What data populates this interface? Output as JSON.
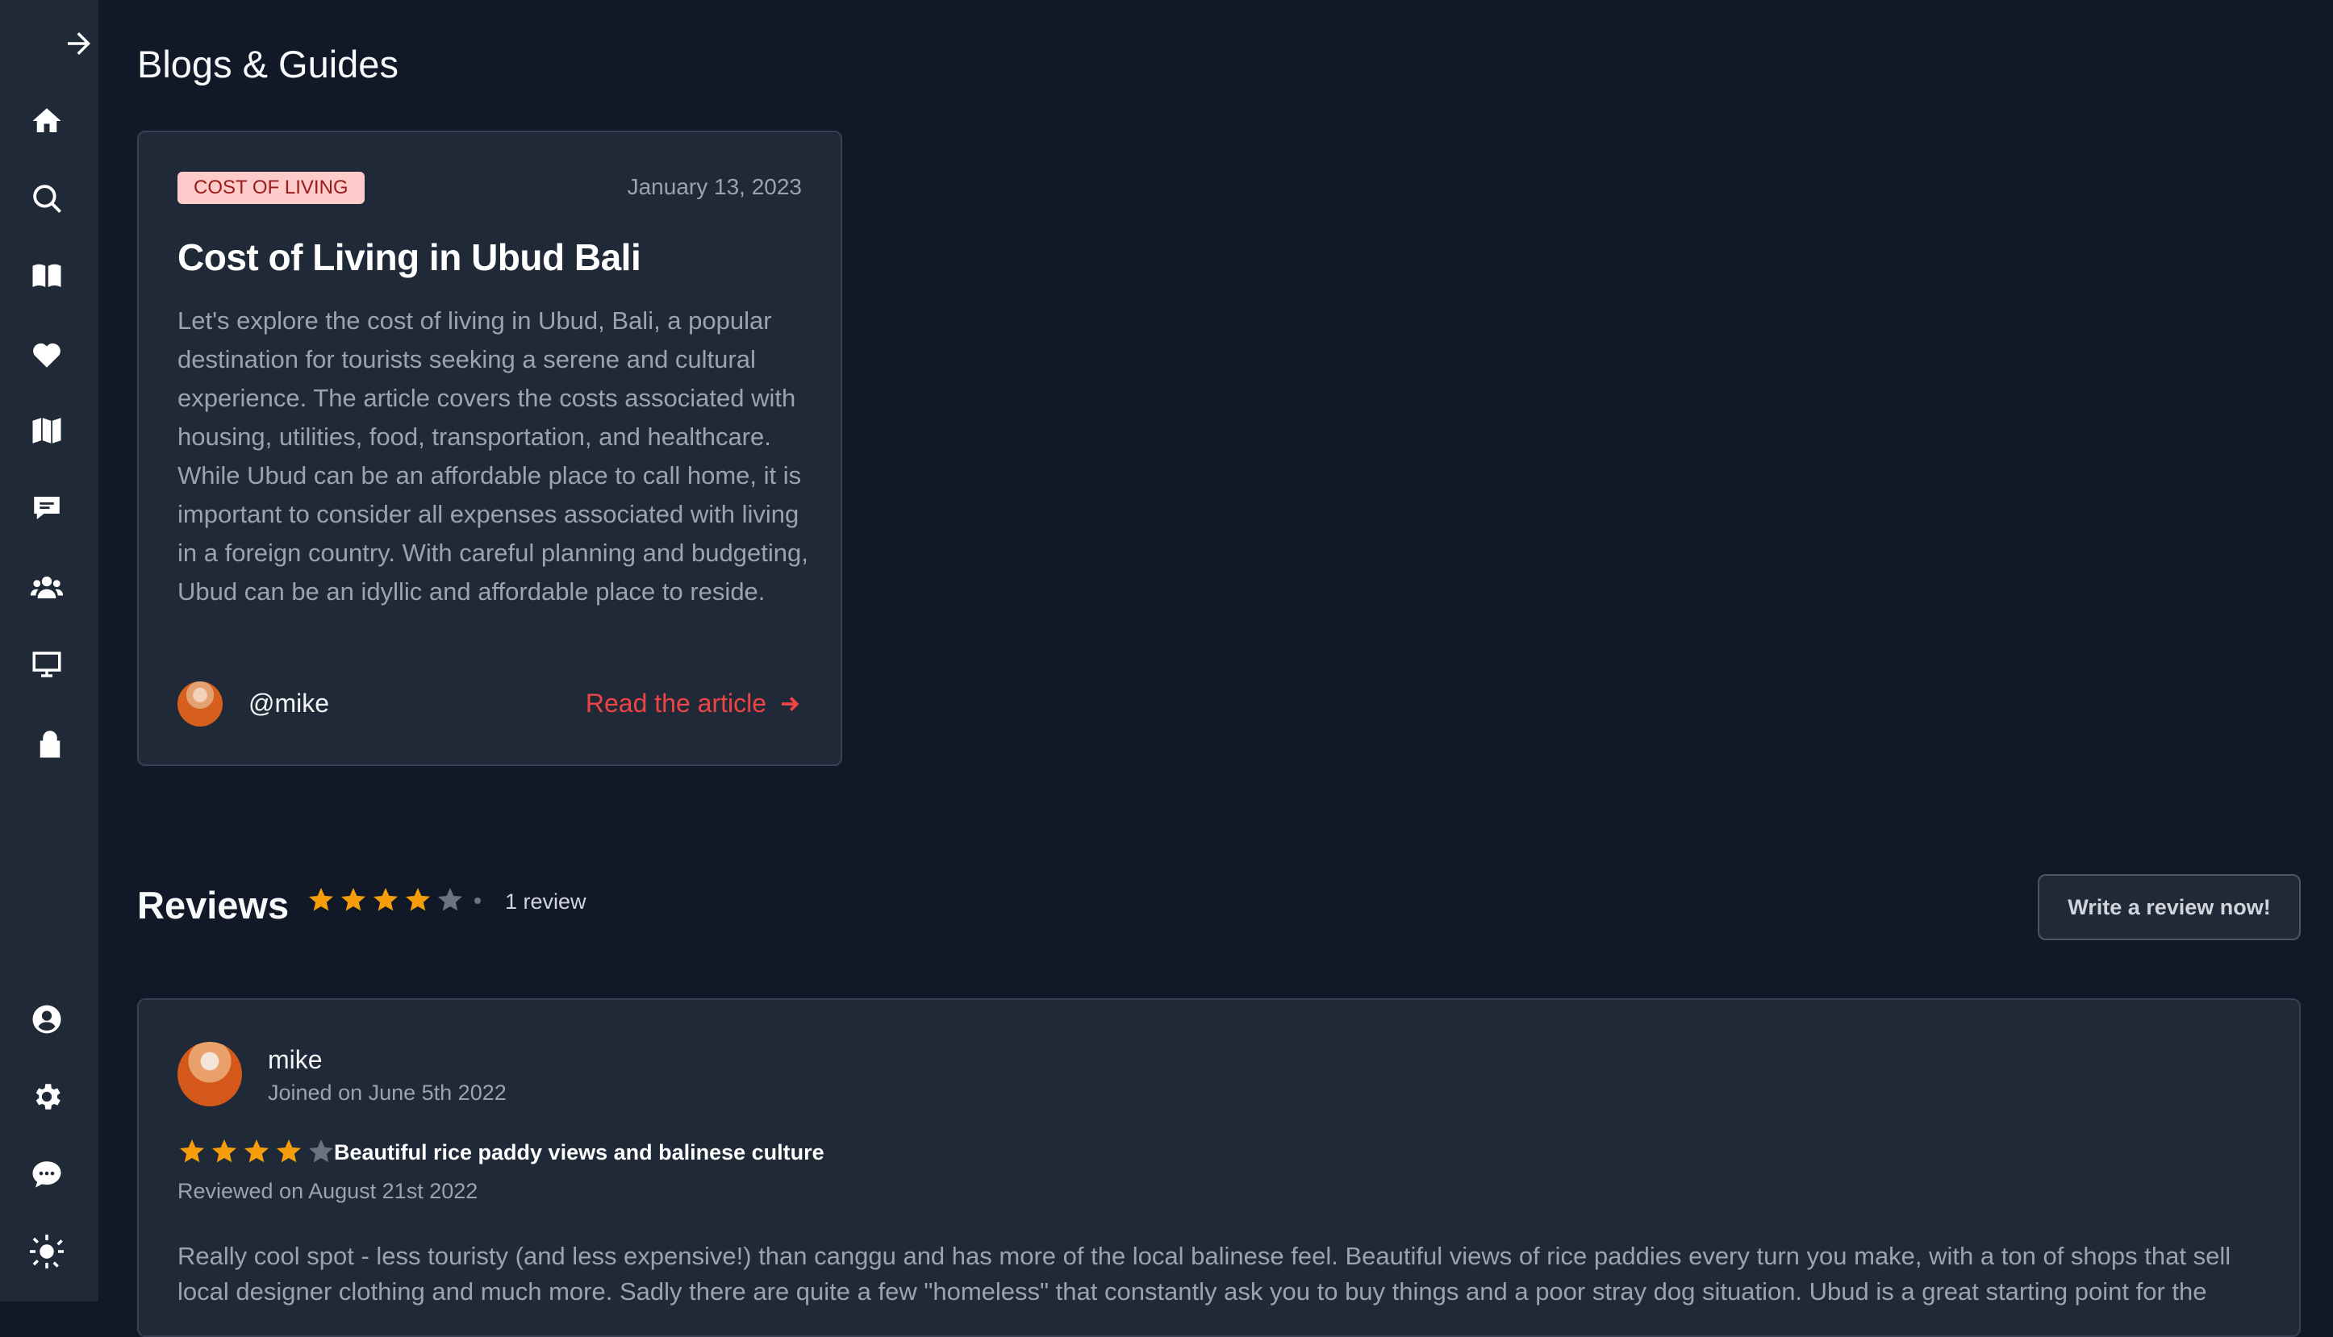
{
  "sidebar": {
    "nav_icons": [
      "expand-arrow-icon",
      "home-icon",
      "search-icon",
      "book-icon",
      "heart-icon",
      "map-icon",
      "comments-icon",
      "users-icon",
      "monitor-icon",
      "lock-icon"
    ],
    "bottom_icons": [
      "user-circle-icon",
      "gear-icon",
      "chat-bubble-icon",
      "sun-icon"
    ]
  },
  "blogs": {
    "title": "Blogs & Guides",
    "card": {
      "tag": "COST OF LIVING",
      "date": "January 13, 2023",
      "title": "Cost of Living in Ubud Bali",
      "body": "Let's explore the cost of living in Ubud, Bali, a popular destination for tourists seeking a serene and cultural experience. The article covers the costs associated with housing, utilities, food, transportation, and healthcare. While Ubud can be an affordable place to call home, it is important to consider all expenses associated with living in a foreign country. With careful planning and budgeting, Ubud can be an idyllic and affordable place to reside.",
      "author": "@mike",
      "read_link": "Read the article"
    }
  },
  "reviews": {
    "title": "Reviews",
    "rating": 4,
    "rating_max": 5,
    "count_label": "1 review",
    "write_button": "Write a review now!",
    "items": [
      {
        "name": "mike",
        "joined": "Joined on June 5th 2022",
        "rating": 4,
        "heading": "Beautiful rice paddy views and balinese culture",
        "reviewed_on": "Reviewed on August 21st 2022",
        "text": "Really cool spot - less touristy (and less expensive!) than canggu and has more of the local balinese feel. Beautiful views of rice paddies every turn you make, with a ton of shops that sell local designer clothing and much more. Sadly there are quite a few \"homeless\" that constantly ask you to buy things and a poor stray dog situation. Ubud is a great starting point for the"
      }
    ]
  },
  "colors": {
    "background": "#111827",
    "sidebar": "#1f2937",
    "accent": "#ef4444",
    "star_filled": "#f59e0b",
    "star_empty": "#6b7280"
  }
}
